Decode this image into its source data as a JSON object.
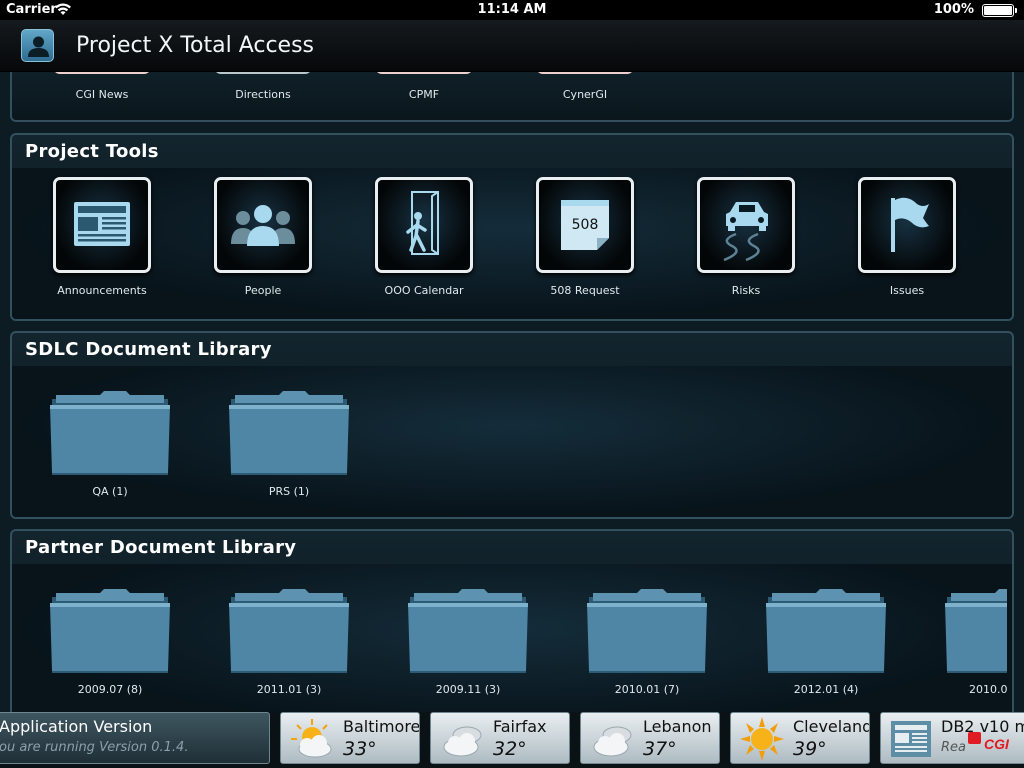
{
  "status_bar": {
    "carrier": "Carrier",
    "time": "11:14 AM",
    "battery": "100%",
    "battery_level": 1.0
  },
  "nav": {
    "title": "Project X Total Access",
    "avatar_icon": "person-icon"
  },
  "news_panel": {
    "items": [
      {
        "label": "CGI News"
      },
      {
        "label": "Directions"
      },
      {
        "label": "CPMF"
      },
      {
        "label": "CynerGI"
      }
    ]
  },
  "project_tools": {
    "title": "Project Tools",
    "items": [
      {
        "label": "Announcements",
        "icon": "newspaper-icon"
      },
      {
        "label": "People",
        "icon": "people-icon"
      },
      {
        "label": "OOO Calendar",
        "icon": "exit-door-icon"
      },
      {
        "label": "508 Request",
        "icon": "note-508-icon",
        "icon_text": "508"
      },
      {
        "label": "Risks",
        "icon": "slippery-car-icon"
      },
      {
        "label": "Issues",
        "icon": "flag-icon"
      }
    ]
  },
  "sdlc_library": {
    "title": "SDLC Document Library",
    "folders": [
      {
        "label": "QA (1)"
      },
      {
        "label": "PRS (1)"
      }
    ]
  },
  "partner_library": {
    "title": "Partner Document Library",
    "folders": [
      {
        "label": "2009.07 (8)"
      },
      {
        "label": "2011.01 (3)"
      },
      {
        "label": "2009.11 (3)"
      },
      {
        "label": "2010.01 (7)"
      },
      {
        "label": "2012.01 (4)"
      },
      {
        "label": "2010.0"
      }
    ]
  },
  "ticker": {
    "app_version": {
      "title": "Application Version",
      "subtitle": "ou are running Version 0.1.4."
    },
    "weather": [
      {
        "city": "Baltimore",
        "temp": "33°",
        "icon": "partly-cloudy-icon"
      },
      {
        "city": "Fairfax",
        "temp": "32°",
        "icon": "cloudy-icon"
      },
      {
        "city": "Lebanon",
        "temp": "37°",
        "icon": "cloudy-icon"
      },
      {
        "city": "Cleveland",
        "temp": "39°",
        "icon": "sunny-icon"
      }
    ],
    "db2": {
      "title": "DB2 v10 m",
      "subtitle": "Rea"
    },
    "logo": "CGI"
  },
  "colors": {
    "accent": "#4a8fb3",
    "folder": "#4f86a6",
    "logo_red": "#e11b22"
  }
}
